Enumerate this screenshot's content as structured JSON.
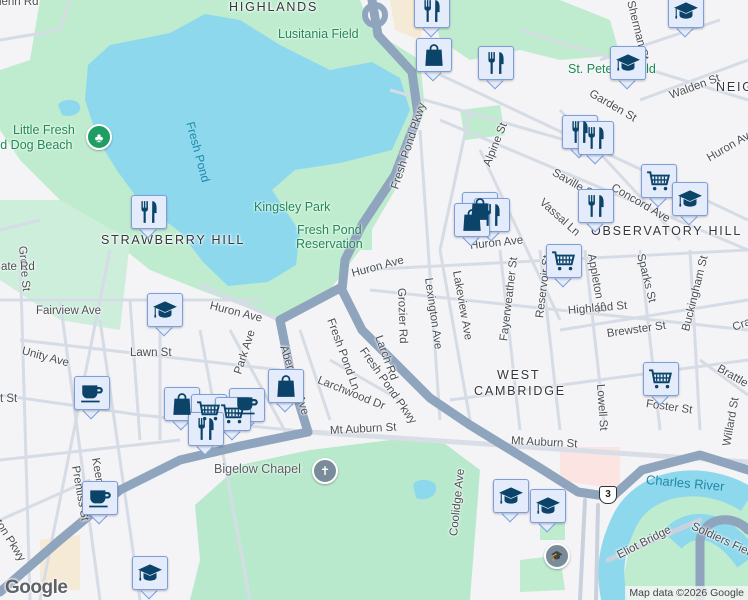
{
  "colors": {
    "background": "#f4f3f6",
    "park": "#bfeccf",
    "water": "#8ed8ee",
    "highway": "#8fa4bd",
    "marker_bg": "#e4ecfb",
    "marker_border": "#7c9fdc",
    "marker_icon": "#0b4468"
  },
  "neighborhoods": {
    "highlands": "HIGHLANDS",
    "strawberry_hill": "STRAWBERRY HILL",
    "observatory_hill": "OBSERVATORY HILL",
    "west": "WEST",
    "cambridge": "CAMBRIDGE",
    "neig": "NEIG"
  },
  "parks": {
    "lusitania": "Lusitania Field",
    "kingsley": "Kingsley Park",
    "reservation_1": "Fresh Pond",
    "reservation_2": "Reservation",
    "st_peters": "St. Peter's Field",
    "dog_beach_1": "Little Fresh",
    "dog_beach_2": "Pond Dog Beach"
  },
  "water": {
    "fresh_pond": "Fresh Pond",
    "charles": "Charles River"
  },
  "pois": {
    "bigelow": "Bigelow Chapel"
  },
  "streets": {
    "glenn": "Glenn Rd",
    "grove": "Grove St",
    "gate": "Gate Rd",
    "fairview": "Fairview Ave",
    "unity": "Unity Ave",
    "lawn": "Lawn St",
    "park_ave": "Park Ave",
    "aberdeen": "Aberdeen Ave",
    "huron_1": "Huron Ave",
    "huron_2": "Huron Ave",
    "huron_3": "Huron Ave",
    "huron_4": "Huron Ave",
    "fresh_pond_ln": "Fresh Pond Ln",
    "larchwood": "Larchwood Dr",
    "larch": "Larch Rd",
    "grozier": "Grozier Rd",
    "lexington": "Lexington Ave",
    "lakeview": "Lakeview Ave",
    "fayerweather": "Fayerweather St",
    "reservoir": "Reservoir St",
    "appleton": "Appleton St",
    "sparks": "Sparks St",
    "buckingham": "Buckingham St",
    "highland": "Highland St",
    "brewster": "Brewster St",
    "craigie": "Craigie",
    "brattle": "Brattle St",
    "lowell": "Lowell St",
    "foster": "Foster St",
    "willard": "Willard St",
    "mt_auburn_1": "Mt Auburn St",
    "mt_auburn_2": "Mt Auburn St",
    "t_st": "t St",
    "coolidge": "Coolidge Ave",
    "pkwy_1": "Fresh Pond Pkwy",
    "pkwy_2": "Fresh Pond Pkwy",
    "alpine": "Alpine St",
    "saville": "Saville St",
    "vassal": "Vassal Ln",
    "concord": "Concord Ave",
    "garden": "Garden St",
    "walden": "Walden St",
    "sherman": "Sherman St",
    "keenan": "Keenan St",
    "prentiss": "Prentiss St",
    "appleton_pkwy": "Appleton Pkwy",
    "eliot": "Eliot Bridge",
    "soldiers": "Soldiers Field Rd"
  },
  "route_shield": "3",
  "markers": [
    {
      "type": "restaurant"
    },
    {
      "type": "shopping"
    },
    {
      "type": "restaurant"
    },
    {
      "type": "school"
    },
    {
      "type": "school"
    },
    {
      "type": "restaurant"
    },
    {
      "type": "restaurant"
    },
    {
      "type": "grocery"
    },
    {
      "type": "school"
    },
    {
      "type": "restaurant"
    },
    {
      "type": "shopping"
    },
    {
      "type": "shopping"
    },
    {
      "type": "shopping"
    },
    {
      "type": "grocery"
    },
    {
      "type": "restaurant"
    },
    {
      "type": "school"
    },
    {
      "type": "coffee"
    },
    {
      "type": "shopping"
    },
    {
      "type": "shopping"
    },
    {
      "type": "grocery"
    },
    {
      "type": "coffee"
    },
    {
      "type": "grocery"
    },
    {
      "type": "restaurant"
    },
    {
      "type": "coffee"
    },
    {
      "type": "school"
    },
    {
      "type": "grocery"
    },
    {
      "type": "school"
    },
    {
      "type": "school"
    }
  ],
  "attribution": "Map data ©2026 Google",
  "logo": "Google"
}
